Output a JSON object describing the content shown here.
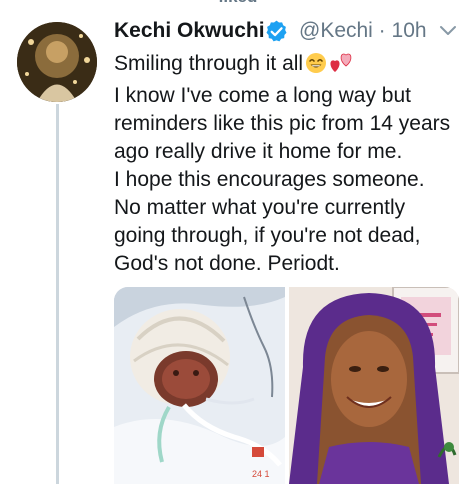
{
  "top_context": {
    "text": "liked"
  },
  "tweet": {
    "author_name": "Kechi Okwuchi",
    "verified": true,
    "handle_time": "@Kechi · 10h",
    "text_lines": [
      "Smiling through it all",
      "I know I've come a long way but",
      "reminders like this pic from 14 years",
      "ago really drive it home for me.",
      "I hope this encourages someone.",
      "No matter what you're currently",
      "going through, if you're not dead,",
      "God's not done. Periodt."
    ],
    "media": {
      "left_photo_timestamp": "24 1"
    }
  },
  "icons": {
    "verified": "verified-badge-icon",
    "menu": "chevron-down-icon",
    "emoji_1": "smiling-face-emoji",
    "emoji_2": "two-hearts-emoji"
  },
  "colors": {
    "verified_blue": "#1da1f2",
    "secondary_text": "#657786",
    "thread_line": "#ccd6dd"
  }
}
